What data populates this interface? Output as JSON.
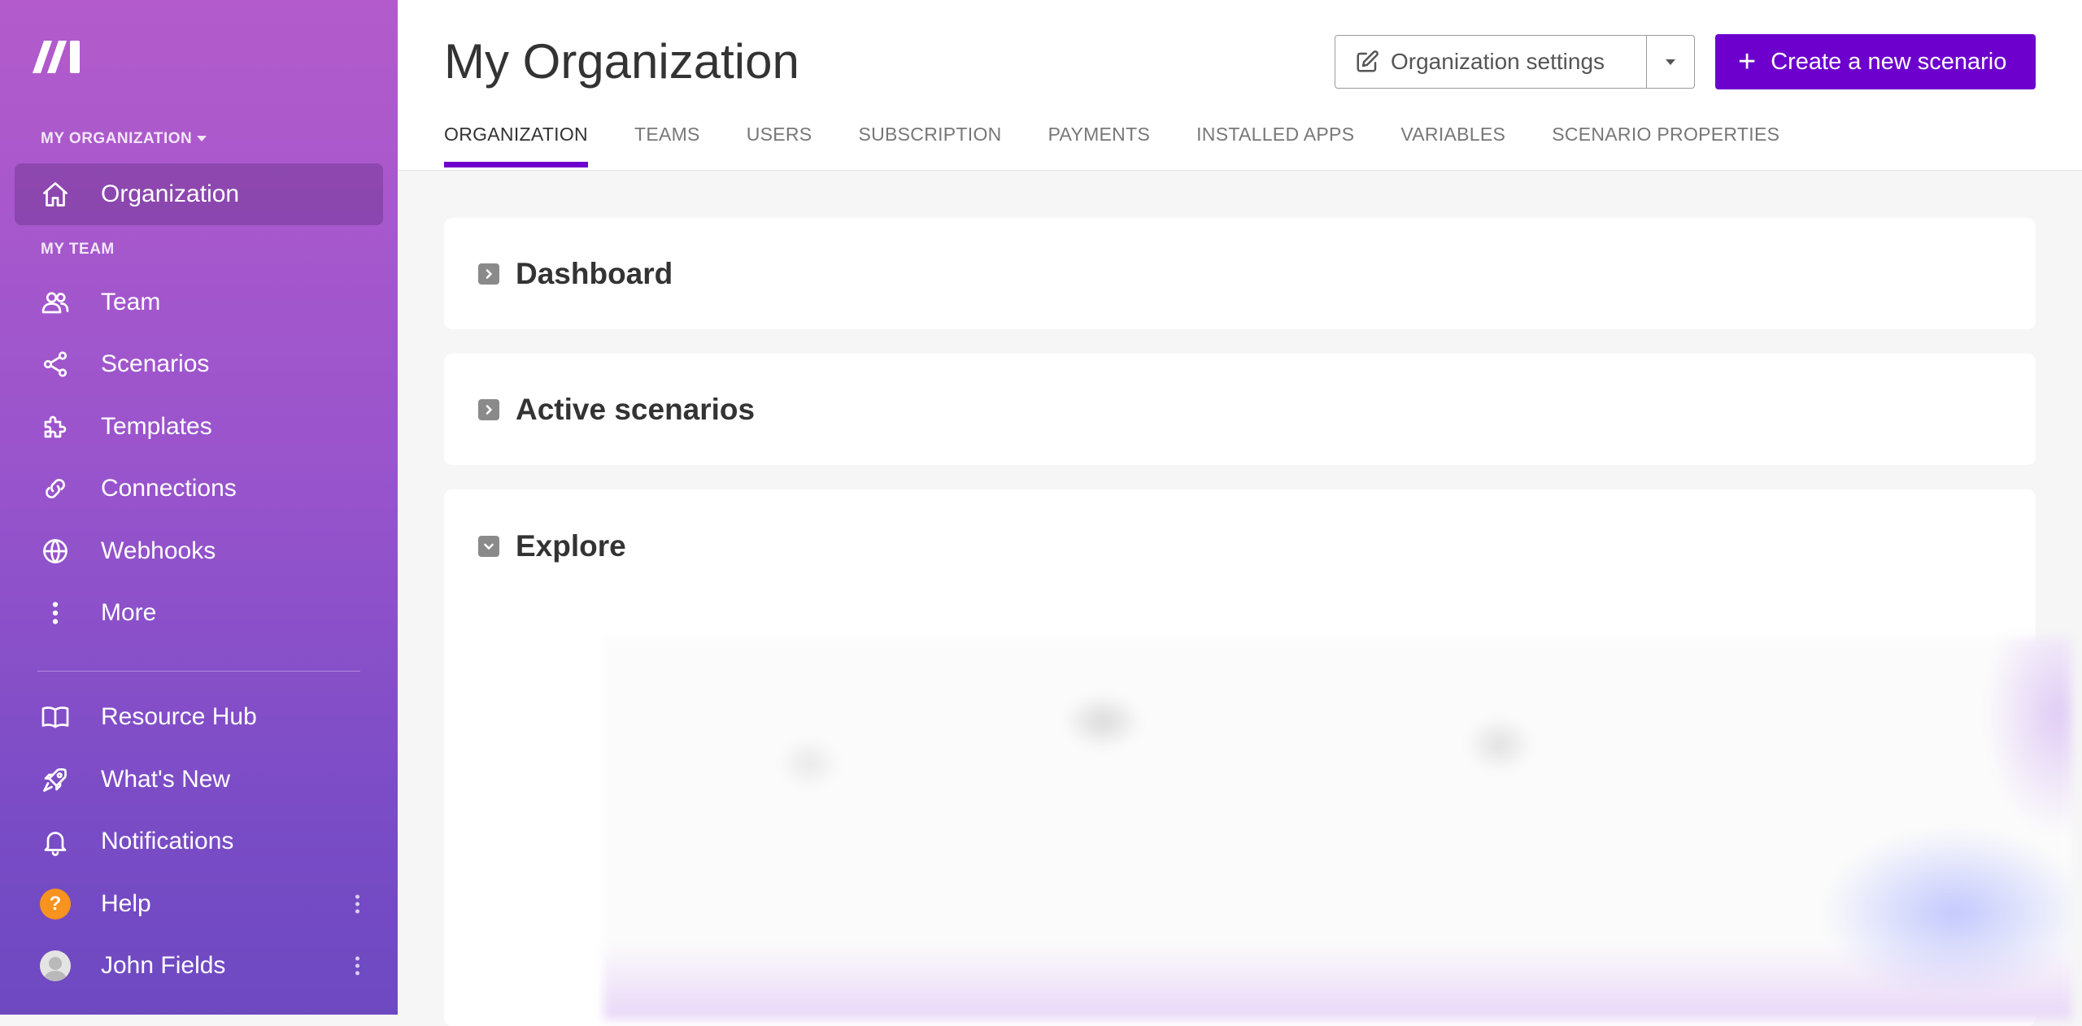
{
  "sidebar": {
    "org_switch": "MY ORGANIZATION",
    "team_section": "MY TEAM",
    "items": [
      {
        "label": "Organization",
        "icon": "home-icon"
      },
      {
        "label": "Team",
        "icon": "users-icon"
      },
      {
        "label": "Scenarios",
        "icon": "share-icon"
      },
      {
        "label": "Templates",
        "icon": "puzzle-icon"
      },
      {
        "label": "Connections",
        "icon": "link-icon"
      },
      {
        "label": "Webhooks",
        "icon": "globe-icon"
      },
      {
        "label": "More",
        "icon": "more-vertical-icon"
      },
      {
        "label": "Resource Hub",
        "icon": "book-icon"
      },
      {
        "label": "What's New",
        "icon": "rocket-icon"
      },
      {
        "label": "Notifications",
        "icon": "bell-icon"
      },
      {
        "label": "Help",
        "icon": "help-icon"
      },
      {
        "label": "John Fields",
        "icon": "avatar"
      }
    ]
  },
  "header": {
    "title": "My Organization",
    "org_settings_label": "Organization settings",
    "create_label": "Create a new scenario",
    "tabs": [
      "ORGANIZATION",
      "TEAMS",
      "USERS",
      "SUBSCRIPTION",
      "PAYMENTS",
      "INSTALLED APPS",
      "VARIABLES",
      "SCENARIO PROPERTIES"
    ]
  },
  "sections": [
    {
      "title": "Dashboard",
      "state": "collapsed"
    },
    {
      "title": "Active scenarios",
      "state": "collapsed"
    },
    {
      "title": "Explore",
      "state": "expanded"
    }
  ],
  "colors": {
    "accent": "#6d00cc",
    "sidebar_top": "#b35bcc",
    "sidebar_bottom": "#6d49c1",
    "help": "#f7931e"
  }
}
